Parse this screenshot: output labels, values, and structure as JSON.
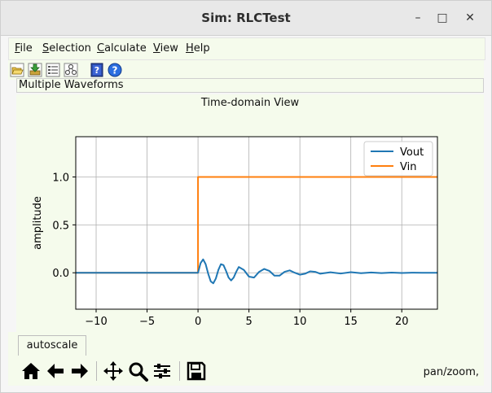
{
  "window": {
    "title": "Sim: RLCTest",
    "minimize_glyph": "–",
    "maximize_glyph": "□",
    "close_glyph": "✕"
  },
  "menu": {
    "items": [
      {
        "label": "File",
        "mnemonic": "F",
        "rest": "ile"
      },
      {
        "label": "Selection",
        "mnemonic": "S",
        "rest": "election"
      },
      {
        "label": "Calculate",
        "mnemonic": "C",
        "rest": "alculate"
      },
      {
        "label": "View",
        "mnemonic": "V",
        "rest": "iew"
      },
      {
        "label": "Help",
        "mnemonic": "H",
        "rest": "elp"
      }
    ]
  },
  "toolbar": {
    "icons": [
      "open-folder-icon",
      "save-download-icon",
      "list-view-icon",
      "tree-gears-icon",
      "help-book-icon",
      "question-icon"
    ]
  },
  "status": {
    "text": "Multiple Waveforms"
  },
  "plot_panel": {
    "title": "Time-domain View"
  },
  "chart_data": {
    "type": "line",
    "title": "",
    "xlabel": "",
    "ylabel": "amplitude",
    "xlim": [
      -12,
      23.5
    ],
    "ylim": [
      -0.38,
      1.42
    ],
    "xticks": [
      -10,
      -5,
      0,
      5,
      10,
      15,
      20
    ],
    "xtick_labels": [
      "−10",
      "−5",
      "0",
      "5",
      "10",
      "15",
      "20"
    ],
    "yticks": [
      0.0,
      0.5,
      1.0
    ],
    "ytick_labels": [
      "0.0",
      "0.5",
      "1.0"
    ],
    "grid": true,
    "legend": "top-right",
    "series": [
      {
        "name": "Vout",
        "color": "#1f77b4",
        "x": [
          -12,
          0,
          0.25,
          0.5,
          0.75,
          1.0,
          1.25,
          1.5,
          1.75,
          2.0,
          2.25,
          2.5,
          2.75,
          3.0,
          3.25,
          3.5,
          3.75,
          4.0,
          4.5,
          5.0,
          5.5,
          6.0,
          6.5,
          7.0,
          7.5,
          8.0,
          8.5,
          9.0,
          9.5,
          10.0,
          10.5,
          11.0,
          11.5,
          12.0,
          13.0,
          14.0,
          15.0,
          16.0,
          17.0,
          18.0,
          19.0,
          20.0,
          21.0,
          22.0,
          23.5
        ],
        "y": [
          0,
          0,
          0.1,
          0.14,
          0.09,
          -0.01,
          -0.09,
          -0.11,
          -0.06,
          0.03,
          0.09,
          0.08,
          0.02,
          -0.05,
          -0.08,
          -0.05,
          0.01,
          0.06,
          0.03,
          -0.04,
          -0.05,
          0.01,
          0.04,
          0.02,
          -0.03,
          -0.03,
          0.01,
          0.025,
          0.0,
          -0.02,
          -0.01,
          0.015,
          0.01,
          -0.01,
          0.005,
          -0.008,
          0.006,
          -0.004,
          0.003,
          -0.003,
          0.002,
          -0.002,
          0.001,
          0,
          0
        ]
      },
      {
        "name": "Vin",
        "color": "#ff7f0e",
        "x": [
          -12,
          0,
          0,
          23.5
        ],
        "y": [
          0,
          0,
          1,
          1
        ]
      }
    ]
  },
  "nav": {
    "autoscale_label": "autoscale",
    "mode_text": "pan/zoom,",
    "buttons": [
      "home-icon",
      "back-arrow-icon",
      "forward-arrow-icon",
      "pan-icon",
      "zoom-icon",
      "configure-subplots-icon",
      "save-figure-icon"
    ]
  }
}
